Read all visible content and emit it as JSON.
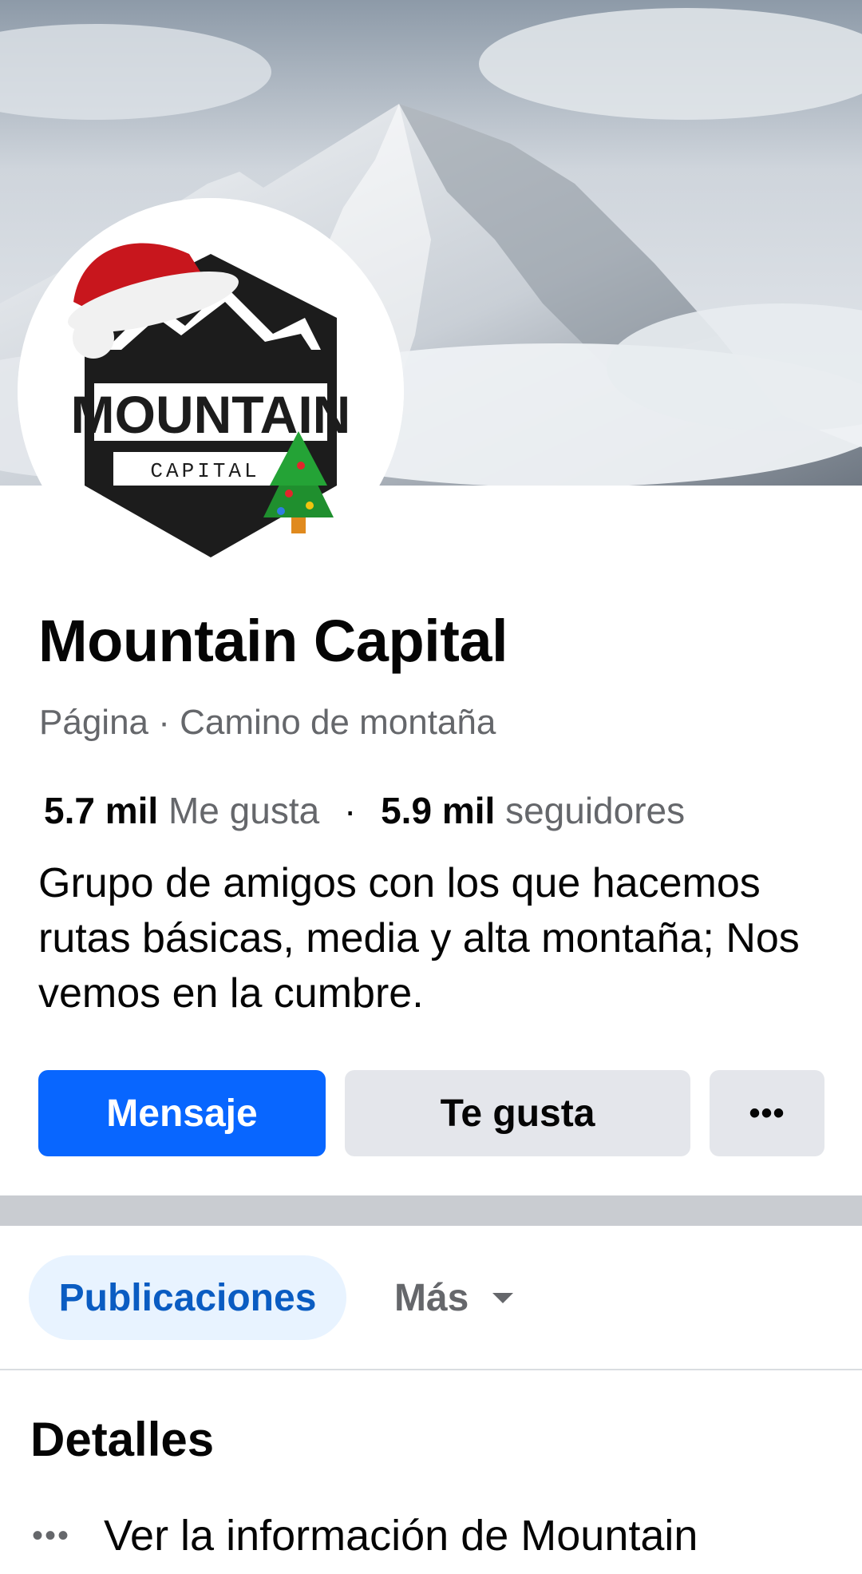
{
  "page": {
    "title": "Mountain Capital",
    "category": "Página · Camino de montaña",
    "likes_count": "5.7 mil",
    "likes_label": "Me gusta",
    "separator": "·",
    "followers_count": "5.9 mil",
    "followers_label": "seguidores",
    "bio": "Grupo de amigos con los que hacemos rutas básicas, media y alta montaña; Nos vemos en la cumbre."
  },
  "avatar": {
    "logo_main": "MOUNTAIN",
    "logo_sub": "CAPITAL"
  },
  "actions": {
    "message_label": "Mensaje",
    "like_label": "Te gusta",
    "more_label": "•••"
  },
  "tabs": {
    "posts_label": "Publicaciones",
    "more_label": "Más"
  },
  "details": {
    "title": "Detalles",
    "row_text": "Ver la información de Mountain",
    "row_icon": "more-dots-icon"
  },
  "colors": {
    "primary_blue": "#0866ff",
    "secondary_button": "#e4e6eb",
    "tab_active_bg": "#e8f3ff",
    "tab_active_text": "#0a5cc2",
    "muted_text": "#65676b"
  }
}
